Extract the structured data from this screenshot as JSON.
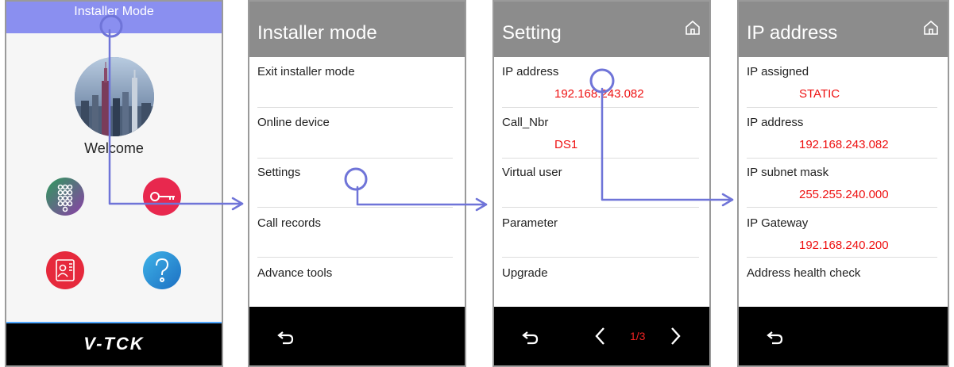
{
  "screen1": {
    "header_title": "Installer Mode",
    "welcome": "Welcome",
    "brand": "V-TCK",
    "icons": [
      "keypad-icon",
      "key-icon",
      "contacts-icon",
      "help-icon"
    ]
  },
  "screen2": {
    "title": "Installer mode",
    "items": [
      "Exit installer mode",
      "Online device",
      "Settings",
      "Call records",
      "Advance tools"
    ]
  },
  "screen3": {
    "title": "Setting",
    "items": [
      {
        "label": "IP address",
        "value": "192.168.243.082"
      },
      {
        "label": "Call_Nbr",
        "value": "DS1"
      },
      {
        "label": "Virtual user",
        "value": ""
      },
      {
        "label": "Parameter",
        "value": ""
      },
      {
        "label": "Upgrade",
        "value": ""
      }
    ],
    "pager": "1/3"
  },
  "screen4": {
    "title": "IP address",
    "items": [
      {
        "label": "IP assigned",
        "value": "STATIC"
      },
      {
        "label": "IP address",
        "value": "192.168.243.082"
      },
      {
        "label": "IP subnet mask",
        "value": "255.255.240.000"
      },
      {
        "label": "IP Gateway",
        "value": "192.168.240.200"
      },
      {
        "label": "Address health check",
        "value": ""
      }
    ]
  },
  "colors": {
    "header_blue": "#8a8ff0",
    "header_gray": "#8c8c8c",
    "value_red": "#ee1111",
    "annotation": "#6f74d8"
  }
}
